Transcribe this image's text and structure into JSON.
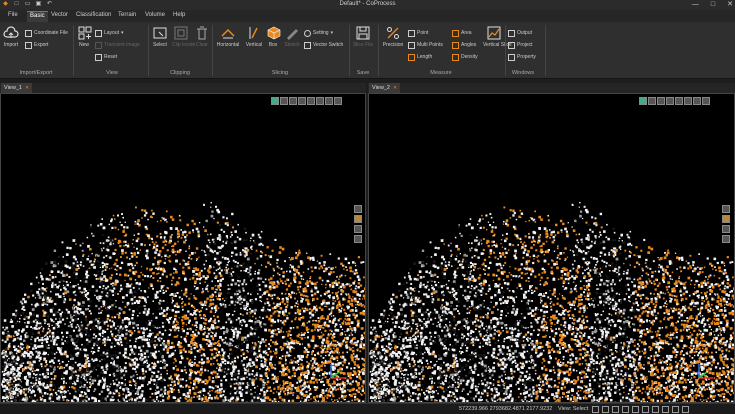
{
  "window": {
    "title": "Default* - CoProcess"
  },
  "menu": [
    "File",
    "Basic",
    "Vector",
    "Classification",
    "Terrain",
    "Volume",
    "Help"
  ],
  "ribbon": {
    "import_export": {
      "label": "Import/Export",
      "import": "Import",
      "coord_file": "Coordinate File",
      "export": "Export"
    },
    "view": {
      "label": "View",
      "new": "New",
      "layout": "Layout",
      "transient": "Transient Image",
      "reset": "Reset"
    },
    "clipping": {
      "label": "Clipping",
      "select": "Select",
      "clip_inside": "Clip Inside",
      "clear": "Clear"
    },
    "slicing": {
      "label": "Slicing",
      "horizontal": "Horizontal",
      "vertical": "Vertical",
      "box": "Box",
      "sketch": "Sketch",
      "setting": "Setting",
      "vector_switch": "Vector Switch"
    },
    "save": {
      "label": "Save",
      "slice_file": "Slice File"
    },
    "measure": {
      "label": "Measure",
      "precision": "Precision",
      "point": "Point",
      "multi_points": "Multi Points",
      "length": "Length",
      "area": "Area",
      "angles": "Angles",
      "density": "Density",
      "vertical_slice": "Vertical Slice"
    },
    "windows": {
      "label": "Windows",
      "output": "Output",
      "project": "Project",
      "property": "Property"
    }
  },
  "views": [
    {
      "tab": "View_1"
    },
    {
      "tab": "View_2"
    }
  ],
  "status": {
    "coords": "572239.966 2793682.4871 2177.9232",
    "view_select": "View: Select"
  },
  "colors": {
    "accent": "#e8891e",
    "background": "#000000",
    "ribbon": "#2f2f2f"
  }
}
